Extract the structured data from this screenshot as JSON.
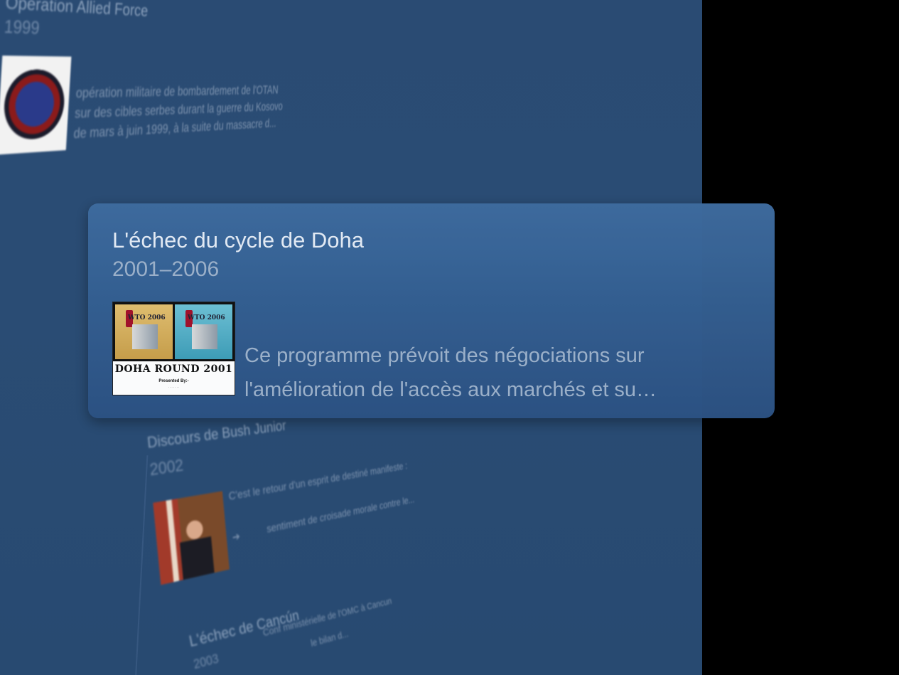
{
  "background_events": [
    {
      "title": "Opération Allied Force",
      "date": "1999",
      "description_lines": [
        "opération militaire de bombardement de l'OTAN",
        "sur des cibles serbes durant la guerre du Kosovo",
        "de mars à juin 1999, à la suite du massacre d..."
      ]
    },
    {
      "title": "Discours de Bush Junior",
      "date": "2002",
      "description_lines": [
        "C'est le retour d'un esprit de destiné manifeste :",
        "sentiment de croisade morale contre le..."
      ]
    },
    {
      "title": "L'échec de Cancún",
      "date": "2003",
      "description_lines": [
        "Conf ministérielle de l'OMC à Cancun",
        "le bilan d..."
      ]
    }
  ],
  "focused_event": {
    "title": "L'échec du cycle de Doha",
    "date": "2001–2006",
    "description_lines": [
      "Ce programme prévoit des négociations sur",
      "l'amélioration de l'accès aux marchés et su…"
    ],
    "thumbnail": {
      "stamp_text": "WTO 2006",
      "caption": "DOHA ROUND 2001",
      "presented_by": "Presented By:-"
    }
  },
  "colors": {
    "panel": "#2a4b73",
    "card": "#3a6699",
    "title_text": "#e6edf6",
    "secondary_text": "#9fb3cb"
  },
  "icons": {
    "read_more": "arrow-icon"
  }
}
